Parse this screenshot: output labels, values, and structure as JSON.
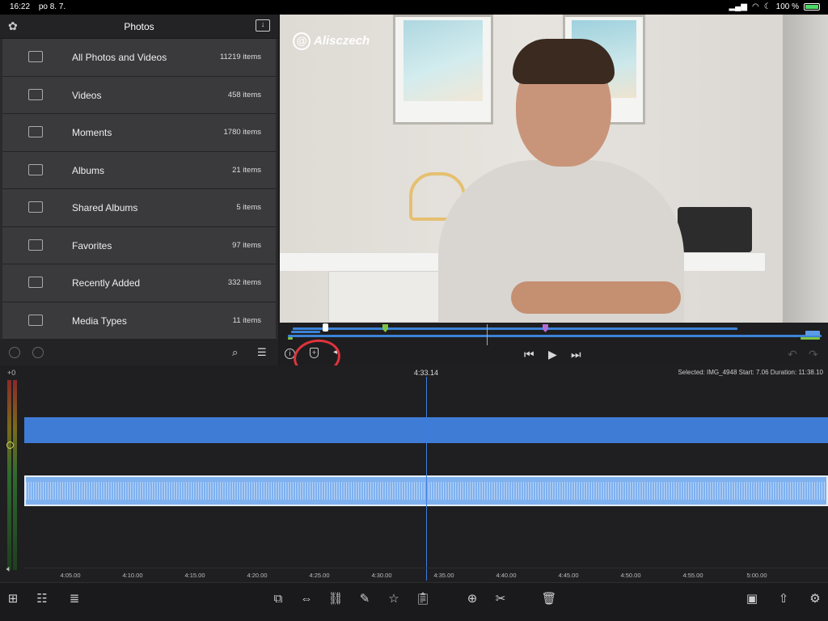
{
  "status_bar": {
    "time": "16:22",
    "date": "po 8. 7.",
    "battery": "100 %",
    "battery_level": 1.0
  },
  "photos": {
    "title": "Photos",
    "albums": [
      {
        "label": "All Photos and Videos",
        "count": "11219 items",
        "icon": "folder-icon"
      },
      {
        "label": "Videos",
        "count": "458 items",
        "icon": "video-camera-icon"
      },
      {
        "label": "Moments",
        "count": "1780 items",
        "icon": "moments-icon"
      },
      {
        "label": "Albums",
        "count": "21 items",
        "icon": "albums-icon"
      },
      {
        "label": "Shared Albums",
        "count": "5 items",
        "icon": "folder-icon"
      },
      {
        "label": "Favorites",
        "count": "97 items",
        "icon": "heart-album-icon"
      },
      {
        "label": "Recently Added",
        "count": "332 items",
        "icon": "folder-icon"
      },
      {
        "label": "Media Types",
        "count": "11 items",
        "icon": "folder-icon"
      }
    ]
  },
  "viewer": {
    "watermark": "Alisczech"
  },
  "timeline": {
    "meter_label": "+0",
    "current_time": "4:33.14",
    "selection_info": "Selected: IMG_4948 Start: 7.06 Duration: 11:38.10",
    "ruler_ticks": [
      "4:05.00",
      "4:10.00",
      "4:15.00",
      "4:20.00",
      "4:25.00",
      "4:30.00",
      "4:35.00",
      "4:40.00",
      "4:45.00",
      "4:50.00",
      "4:55.00",
      "5:00.00"
    ]
  },
  "colors": {
    "accent": "#3f7cd6",
    "audio_clip": "#7fb1ef",
    "annotation": "#e0333b",
    "marker_green": "#7fc241",
    "marker_purple": "#b56ad8"
  }
}
